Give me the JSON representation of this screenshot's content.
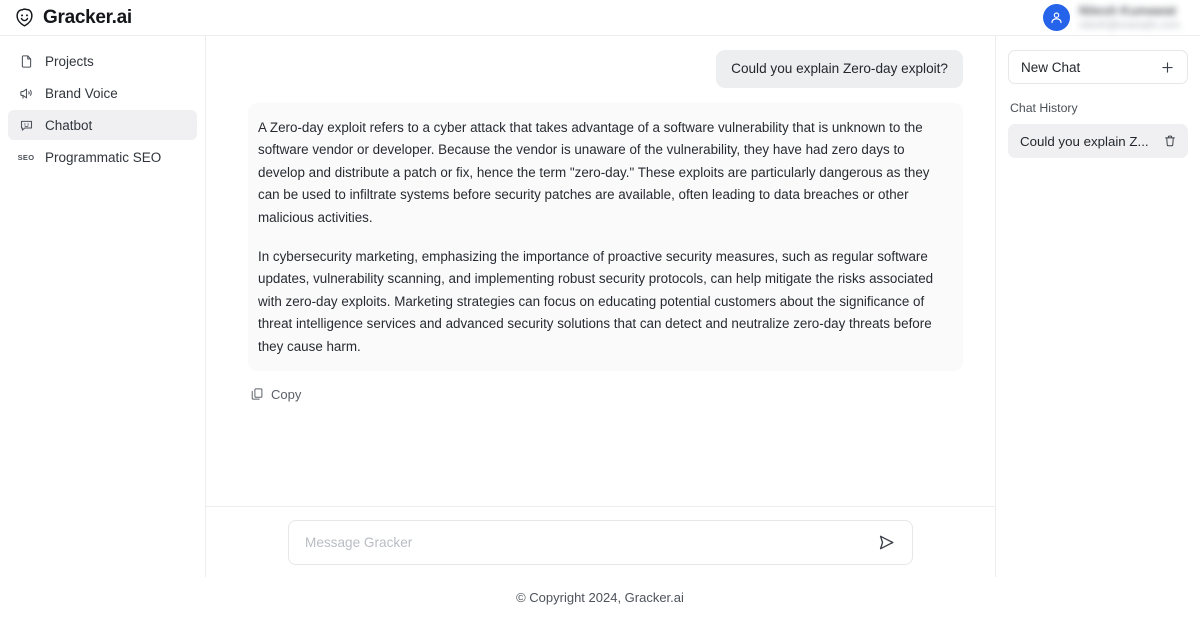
{
  "brand": {
    "name": "Gracker.ai",
    "logo_icon": "gracker-shield-smiley-icon"
  },
  "user": {
    "name": "Nitesh Kumawat",
    "email": "nitesh@example.com",
    "avatar_icon": "person-icon"
  },
  "sidebar": {
    "items": [
      {
        "label": "Projects",
        "icon": "document-icon",
        "active": false
      },
      {
        "label": "Brand Voice",
        "icon": "megaphone-icon",
        "active": false
      },
      {
        "label": "Chatbot",
        "icon": "chat-smiley-icon",
        "active": true
      },
      {
        "label": "Programmatic SEO",
        "icon": "seo-icon",
        "active": false
      }
    ]
  },
  "chat": {
    "user_message": "Could you explain Zero-day exploit?",
    "assistant_paragraphs": [
      "A Zero-day exploit refers to a cyber attack that takes advantage of a software vulnerability that is unknown to the software vendor or developer. Because the vendor is unaware of the vulnerability, they have had zero days to develop and distribute a patch or fix, hence the term \"zero-day.\" These exploits are particularly dangerous as they can be used to infiltrate systems before security patches are available, often leading to data breaches or other malicious activities.",
      "In cybersecurity marketing, emphasizing the importance of proactive security measures, such as regular software updates, vulnerability scanning, and implementing robust security protocols, can help mitigate the risks associated with zero-day exploits. Marketing strategies can focus on educating potential customers about the significance of threat intelligence services and advanced security solutions that can detect and neutralize zero-day threats before they cause harm."
    ],
    "copy_label": "Copy",
    "copy_icon": "copy-icon"
  },
  "composer": {
    "placeholder": "Message Gracker",
    "value": "",
    "send_icon": "send-icon"
  },
  "right_panel": {
    "new_chat_label": "New Chat",
    "new_chat_icon": "plus-icon",
    "history_label": "Chat History",
    "history_items": [
      {
        "title": "Could you explain Z...",
        "delete_icon": "trash-icon"
      }
    ]
  },
  "footer": {
    "text": "© Copyright 2024, Gracker.ai"
  },
  "colors": {
    "accent": "#2563eb",
    "active_bg": "#f0f0f2",
    "user_bubble_bg": "#eceef0",
    "assistant_bubble_bg": "#fafafb",
    "border": "#ededf0"
  }
}
